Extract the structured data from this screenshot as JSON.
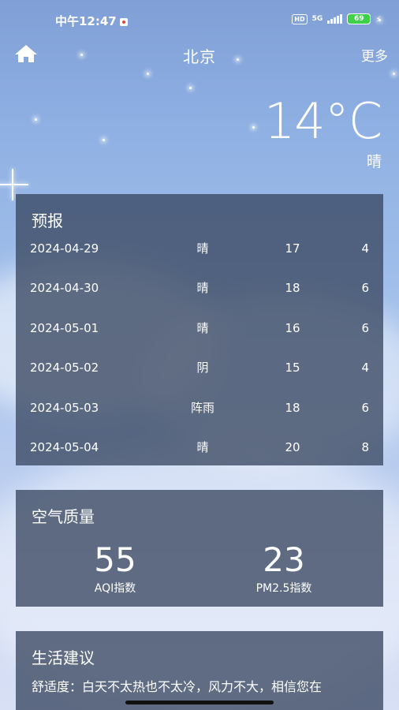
{
  "status_bar": {
    "time": "中午12:47",
    "hd_label": "HD",
    "network": "5G",
    "battery": "69"
  },
  "header": {
    "city": "北京",
    "more_label": "更多"
  },
  "current": {
    "temperature": "14°C",
    "condition": "晴"
  },
  "forecast": {
    "title": "预报",
    "rows": [
      {
        "date": "2024-04-29",
        "condition": "晴",
        "max": "17",
        "min": "4"
      },
      {
        "date": "2024-04-30",
        "condition": "晴",
        "max": "18",
        "min": "6"
      },
      {
        "date": "2024-05-01",
        "condition": "晴",
        "max": "16",
        "min": "6"
      },
      {
        "date": "2024-05-02",
        "condition": "阴",
        "max": "15",
        "min": "4"
      },
      {
        "date": "2024-05-03",
        "condition": "阵雨",
        "max": "18",
        "min": "6"
      },
      {
        "date": "2024-05-04",
        "condition": "晴",
        "max": "20",
        "min": "8"
      }
    ]
  },
  "air_quality": {
    "title": "空气质量",
    "aqi_value": "55",
    "aqi_label": "AQI指数",
    "pm25_value": "23",
    "pm25_label": "PM2.5指数"
  },
  "life_advice": {
    "title": "生活建议",
    "comfort": "舒适度：白天不太热也不太冷，风力不大，相信您在"
  },
  "icons": {
    "home": "home-icon",
    "charging": "bolt-icon"
  }
}
